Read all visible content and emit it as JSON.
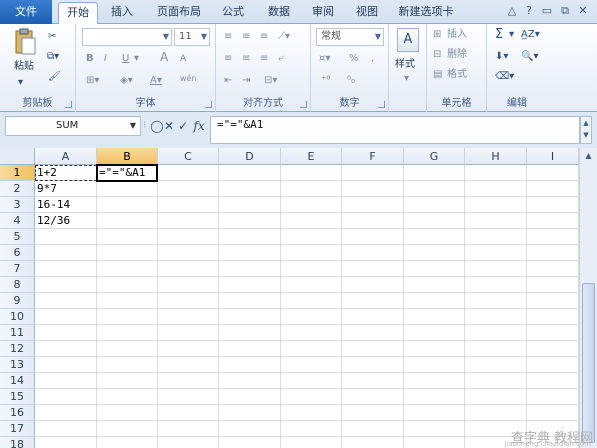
{
  "tabs": {
    "file": "文件",
    "home": "开始",
    "insert": "插入",
    "page_layout": "页面布局",
    "formulas": "公式",
    "data": "数据",
    "review": "审阅",
    "view": "视图",
    "new_tab": "新建选项卡"
  },
  "window_controls": {
    "help": "?",
    "minimize": "▭",
    "restore": "⧉",
    "close": "✕"
  },
  "ribbon": {
    "clipboard": {
      "label": "剪贴板",
      "paste": "粘贴"
    },
    "font": {
      "label": "字体",
      "size": "11",
      "bold": "B",
      "italic": "I",
      "underline": "U",
      "grow": "A",
      "shrink": "A",
      "wen": "wén"
    },
    "alignment": {
      "label": "对齐方式"
    },
    "number": {
      "label": "数字",
      "format": "常规",
      "percent": "%",
      "comma": ","
    },
    "styles": {
      "label": "样式"
    },
    "cells": {
      "label": "单元格",
      "insert": "插入",
      "delete": "删除",
      "format": "格式"
    },
    "editing": {
      "label": "编辑",
      "sum": "Σ"
    }
  },
  "formula_bar": {
    "name_box": "SUM",
    "cancel": "✕",
    "enter": "✓",
    "fx": "fx",
    "formula": "=\"=\"&A1"
  },
  "columns": [
    "A",
    "B",
    "C",
    "D",
    "E",
    "F",
    "G",
    "H",
    "I"
  ],
  "rows": [
    "1",
    "2",
    "3",
    "4",
    "5",
    "6",
    "7",
    "8",
    "9",
    "10",
    "11",
    "12",
    "13",
    "14",
    "15",
    "16",
    "17",
    "18"
  ],
  "cells": {
    "A1": "1+2",
    "A2": "9*7",
    "A3": "16-14",
    "A4": "12/36",
    "B1": "=\"=\"&A1"
  },
  "watermark": {
    "main": "查字典 教程网",
    "sub": "jiaocheng.chazidian.com"
  }
}
